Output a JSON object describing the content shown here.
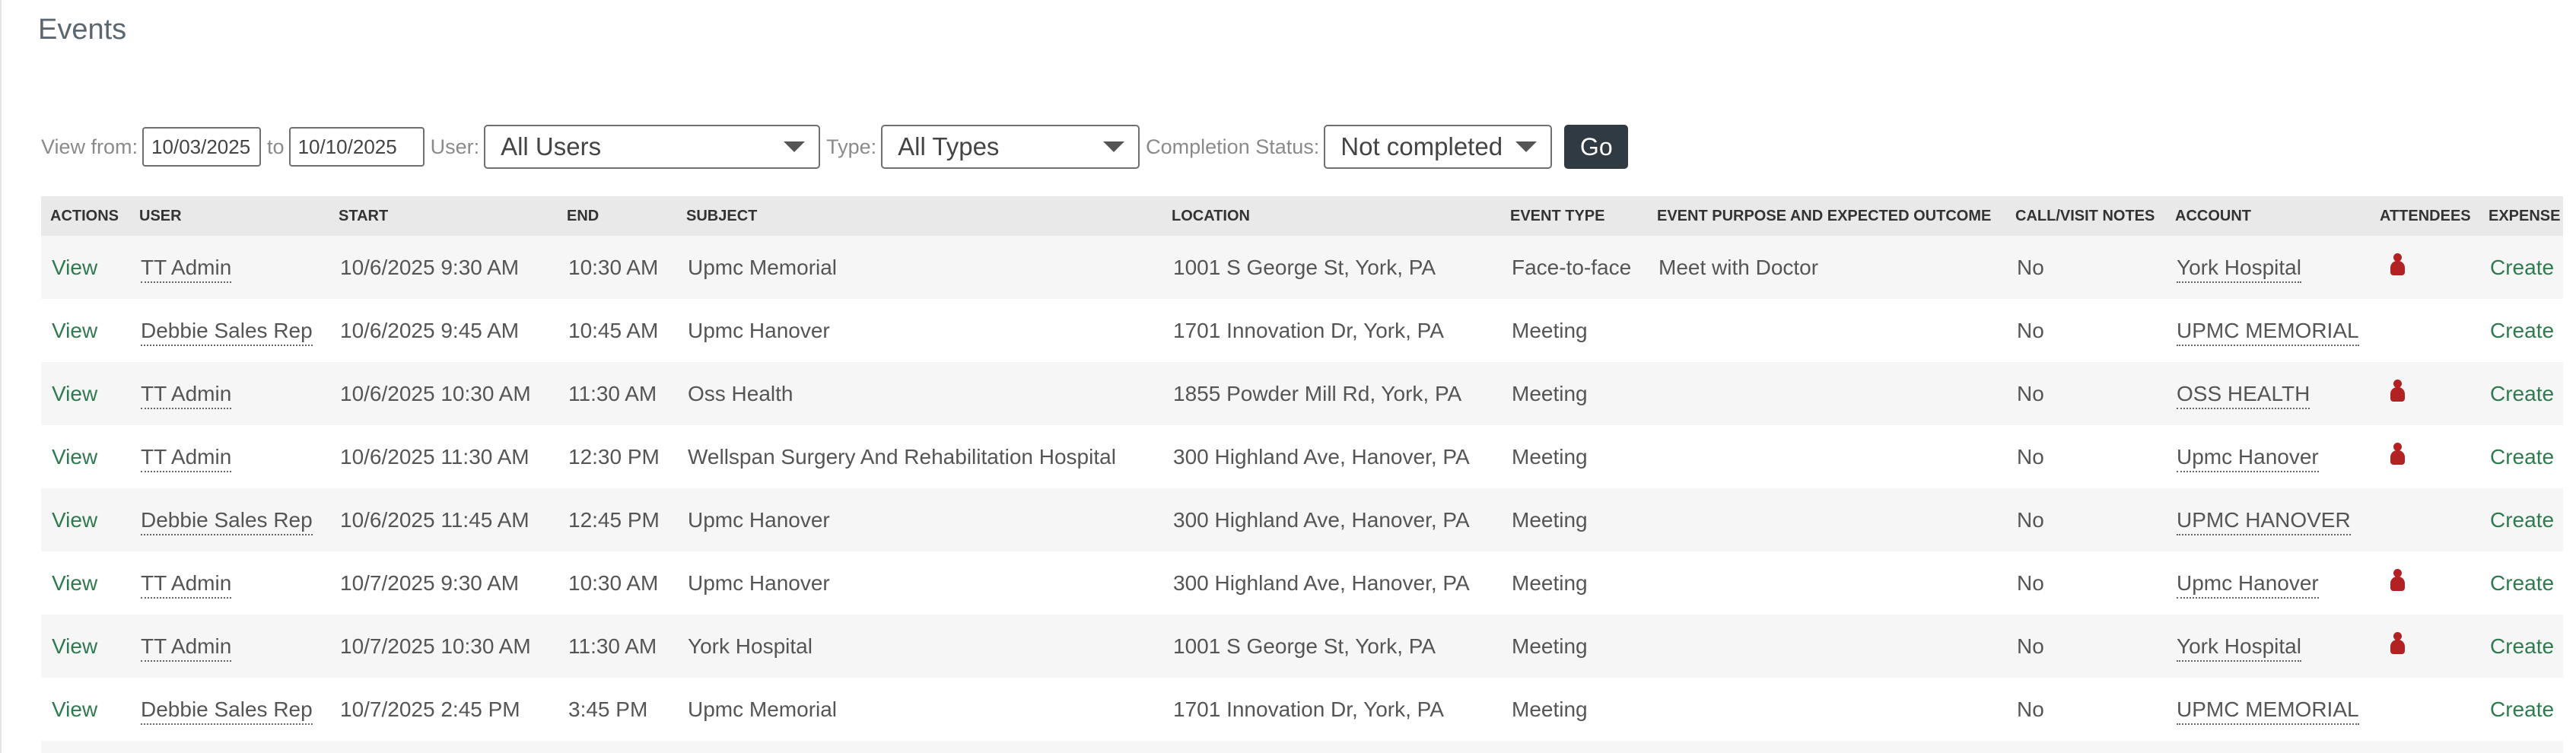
{
  "page": {
    "title": "Events"
  },
  "filters": {
    "view_from_label": "View from:",
    "from_date": "10/03/2025",
    "to_label": "to",
    "to_date": "10/10/2025",
    "user_label": "User:",
    "user_value": "All Users",
    "type_label": "Type:",
    "type_value": "All Types",
    "completion_label": "Completion Status:",
    "completion_value": "Not completed",
    "go_label": "Go"
  },
  "table": {
    "columns": [
      "ACTIONS",
      "USER",
      "START",
      "END",
      "SUBJECT",
      "LOCATION",
      "EVENT TYPE",
      "EVENT PURPOSE AND EXPECTED OUTCOME",
      "CALL/VISIT NOTES",
      "ACCOUNT",
      "ATTENDEES",
      "EXPENSE"
    ],
    "rows": [
      {
        "action": "View",
        "user": "TT Admin",
        "start": "10/6/2025 9:30 AM",
        "end": "10:30 AM",
        "subject": "Upmc Memorial",
        "location": "1001 S George St, York, PA",
        "event_type": "Face-to-face",
        "purpose": "Meet with Doctor",
        "notes": "No",
        "account": "York Hospital",
        "attendees_icon": "person-icon",
        "expense": "Create"
      },
      {
        "action": "View",
        "user": "Debbie Sales Rep",
        "start": "10/6/2025 9:45 AM",
        "end": "10:45 AM",
        "subject": "Upmc Hanover",
        "location": "1701 Innovation Dr, York, PA",
        "event_type": "Meeting",
        "purpose": "",
        "notes": "No",
        "account": "UPMC MEMORIAL",
        "attendees_icon": "",
        "expense": "Create"
      },
      {
        "action": "View",
        "user": "TT Admin",
        "start": "10/6/2025 10:30 AM",
        "end": "11:30 AM",
        "subject": "Oss Health",
        "location": "1855 Powder Mill Rd, York, PA",
        "event_type": "Meeting",
        "purpose": "",
        "notes": "No",
        "account": "OSS HEALTH",
        "attendees_icon": "person-icon",
        "expense": "Create"
      },
      {
        "action": "View",
        "user": "TT Admin",
        "start": "10/6/2025 11:30 AM",
        "end": "12:30 PM",
        "subject": "Wellspan Surgery And Rehabilitation Hospital",
        "location": "300 Highland Ave, Hanover, PA",
        "event_type": "Meeting",
        "purpose": "",
        "notes": "No",
        "account": "Upmc Hanover",
        "attendees_icon": "person-icon",
        "expense": "Create"
      },
      {
        "action": "View",
        "user": "Debbie Sales Rep",
        "start": "10/6/2025 11:45 AM",
        "end": "12:45 PM",
        "subject": "Upmc Hanover",
        "location": "300 Highland Ave, Hanover, PA",
        "event_type": "Meeting",
        "purpose": "",
        "notes": "No",
        "account": "UPMC HANOVER",
        "attendees_icon": "",
        "expense": "Create"
      },
      {
        "action": "View",
        "user": "TT Admin",
        "start": "10/7/2025 9:30 AM",
        "end": "10:30 AM",
        "subject": "Upmc Hanover",
        "location": "300 Highland Ave, Hanover, PA",
        "event_type": "Meeting",
        "purpose": "",
        "notes": "No",
        "account": "Upmc Hanover",
        "attendees_icon": "person-icon",
        "expense": "Create"
      },
      {
        "action": "View",
        "user": "TT Admin",
        "start": "10/7/2025 10:30 AM",
        "end": "11:30 AM",
        "subject": "York Hospital",
        "location": "1001 S George St, York, PA",
        "event_type": "Meeting",
        "purpose": "",
        "notes": "No",
        "account": "York Hospital",
        "attendees_icon": "person-icon",
        "expense": "Create"
      },
      {
        "action": "View",
        "user": "Debbie Sales Rep",
        "start": "10/7/2025 2:45 PM",
        "end": "3:45 PM",
        "subject": "Upmc Memorial",
        "location": "1701 Innovation Dr, York, PA",
        "event_type": "Meeting",
        "purpose": "",
        "notes": "No",
        "account": "UPMC MEMORIAL",
        "attendees_icon": "",
        "expense": "Create"
      }
    ]
  },
  "colors": {
    "link": "#2f7a4e",
    "button": "#2f3a42",
    "attendee_icon": "#b22222",
    "header_bg": "#e9e9e9"
  }
}
